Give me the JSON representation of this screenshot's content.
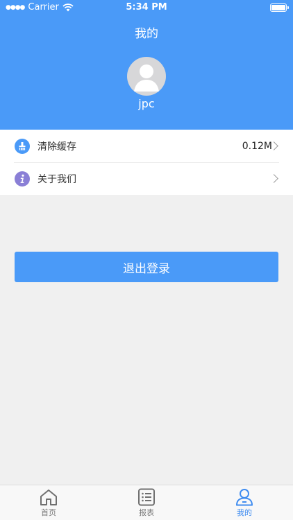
{
  "status_bar": {
    "carrier": "Carrier",
    "time": "5:34 PM"
  },
  "header": {
    "title": "我的",
    "username": "jpc"
  },
  "menu": {
    "items": [
      {
        "label": "清除缓存",
        "value": "0.12M",
        "icon": "broom-icon"
      },
      {
        "label": "关于我们",
        "value": "",
        "icon": "info-icon"
      }
    ]
  },
  "logout_label": "退出登录",
  "tabs": [
    {
      "label": "首页",
      "icon": "home-icon"
    },
    {
      "label": "报表",
      "icon": "list-icon"
    },
    {
      "label": "我的",
      "icon": "user-icon"
    }
  ],
  "colors": {
    "accent": "#4a9af8",
    "active_tab": "#3f8cf0",
    "info_icon": "#8a7fd6"
  }
}
